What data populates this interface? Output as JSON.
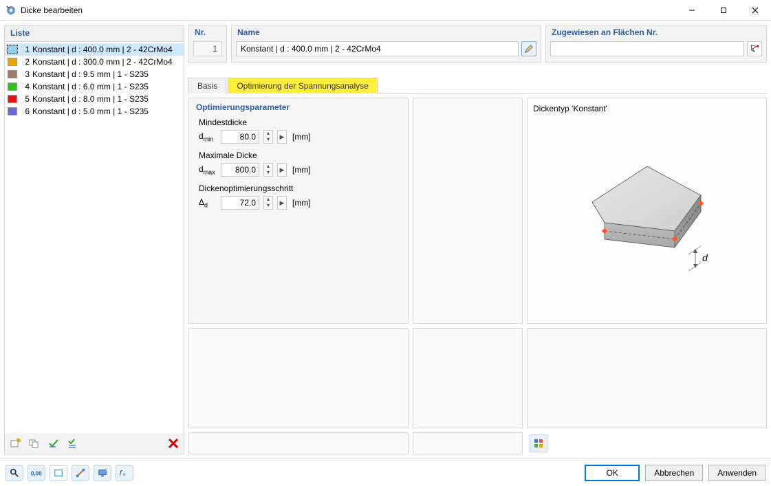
{
  "window": {
    "title": "Dicke bearbeiten"
  },
  "list": {
    "header": "Liste",
    "items": [
      {
        "num": "1",
        "label": "Konstant | d : 400.0 mm | 2 - 42CrMo4",
        "color": "#8fd1ff"
      },
      {
        "num": "2",
        "label": "Konstant | d : 300.0 mm | 2 - 42CrMo4",
        "color": "#e6a700"
      },
      {
        "num": "3",
        "label": "Konstant | d : 9.5 mm | 1 - S235",
        "color": "#a07b6a"
      },
      {
        "num": "4",
        "label": "Konstant | d : 6.0 mm | 1 - S235",
        "color": "#30c21a"
      },
      {
        "num": "5",
        "label": "Konstant | d : 8.0 mm | 1 - S235",
        "color": "#e31313"
      },
      {
        "num": "6",
        "label": "Konstant | d : 5.0 mm | 1 - S235",
        "color": "#6a6ad6"
      }
    ]
  },
  "nr": {
    "header": "Nr.",
    "value": "1"
  },
  "name": {
    "header": "Name",
    "value": "Konstant | d : 400.0 mm | 2 - 42CrMo4"
  },
  "assigned": {
    "header": "Zugewiesen an Flächen Nr."
  },
  "tabs": {
    "basis": "Basis",
    "opt": "Optimierung der Spannungsanalyse"
  },
  "params": {
    "header": "Optimierungsparameter",
    "min": {
      "label": "Mindestdicke",
      "sym": "d",
      "sub": "min",
      "value": "80.0",
      "unit": "[mm]"
    },
    "max": {
      "label": "Maximale Dicke",
      "sym": "d",
      "sub": "max",
      "value": "800.0",
      "unit": "[mm]"
    },
    "step": {
      "label": "Dickenoptimierungsschritt",
      "sym": "Δ",
      "sub": "d",
      "value": "72.0",
      "unit": "[mm]"
    }
  },
  "preview": {
    "header": "Dickentyp  'Konstant'",
    "dim_label": "d"
  },
  "footer": {
    "ok": "OK",
    "cancel": "Abbrechen",
    "apply": "Anwenden"
  }
}
